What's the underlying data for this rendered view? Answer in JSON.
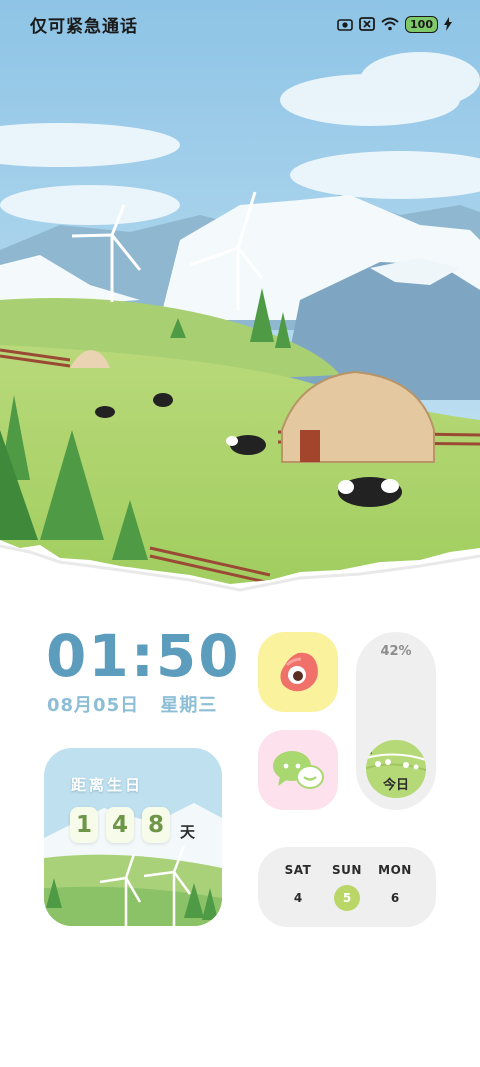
{
  "status_bar": {
    "carrier": "仅可紧急通话",
    "battery": "100",
    "icons": [
      "camera-icon",
      "sim-icon",
      "wifi-icon",
      "battery-icon",
      "charging-icon"
    ]
  },
  "clock": {
    "time": "01:50",
    "date": "08月05日",
    "weekday": "星期三"
  },
  "countdown": {
    "title": "距离生日",
    "digits": [
      "1",
      "4",
      "8"
    ],
    "unit": "天"
  },
  "apps": [
    {
      "name": "weibo",
      "icon": "weibo-icon"
    },
    {
      "name": "wechat",
      "icon": "wechat-icon"
    }
  ],
  "battery_widget": {
    "percent": "42%",
    "level": 0.42,
    "today": "今日"
  },
  "calendar": {
    "days": [
      {
        "label": "SAT",
        "date": "4",
        "active": false
      },
      {
        "label": "SUN",
        "date": "5",
        "active": true
      },
      {
        "label": "MON",
        "date": "6",
        "active": false
      }
    ]
  },
  "colors": {
    "clock": "#5c9cbc",
    "date": "#8dbed6",
    "weibo_bg": "#fbf29e",
    "wechat_bg": "#fde1ec",
    "active_date": "#b9d667",
    "widget_bg": "#efefef"
  }
}
